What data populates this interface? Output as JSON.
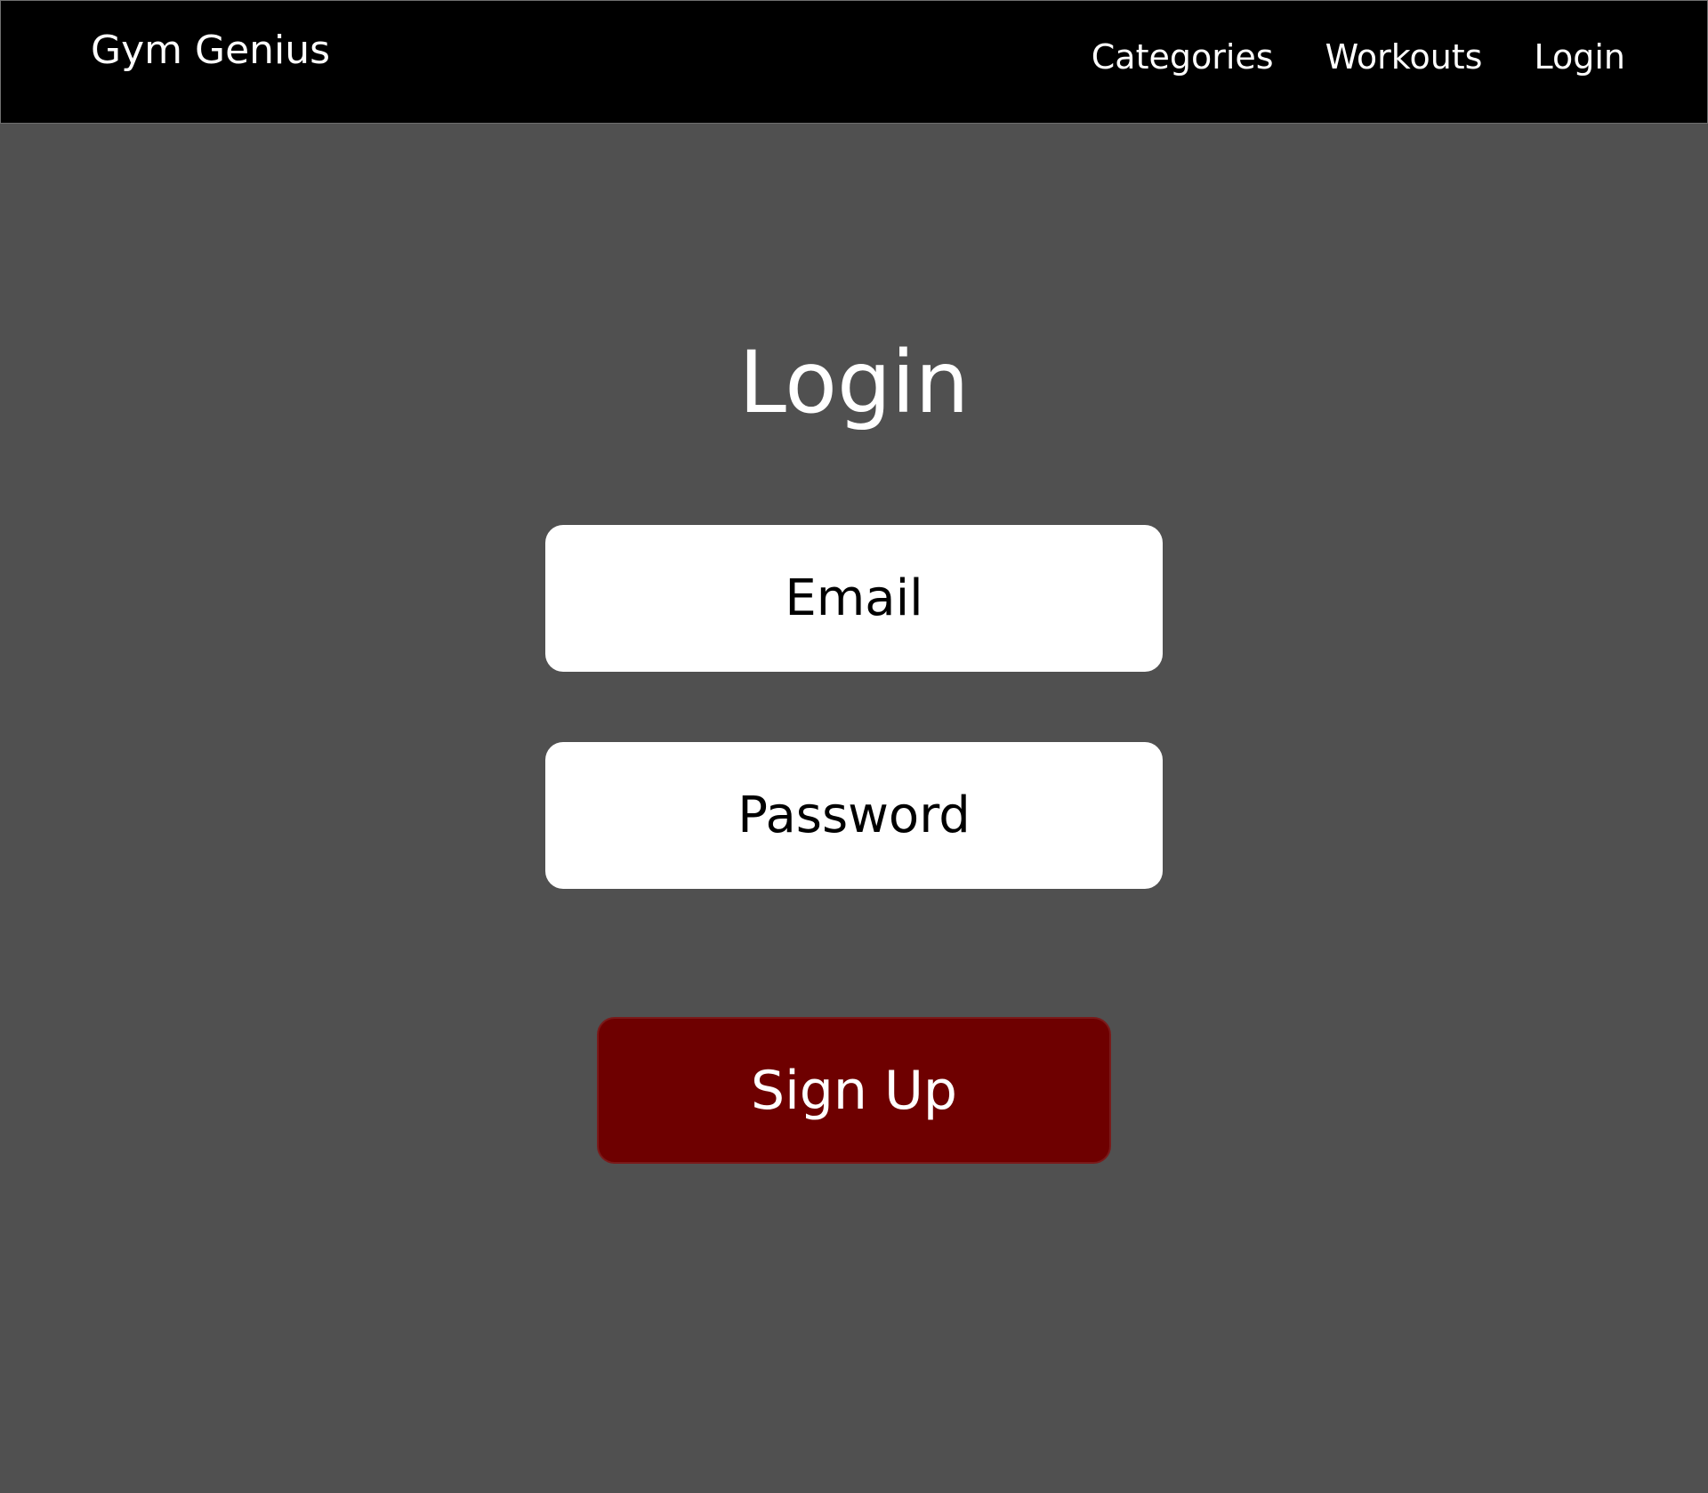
{
  "header": {
    "brand": "Gym Genius",
    "nav": [
      {
        "label": "Categories"
      },
      {
        "label": "Workouts"
      },
      {
        "label": "Login"
      }
    ]
  },
  "main": {
    "title": "Login",
    "email_field": {
      "placeholder": "Email"
    },
    "password_field": {
      "placeholder": "Password"
    },
    "signup_button": {
      "label": "Sign Up"
    }
  },
  "colors": {
    "page_background": "#505050",
    "navbar_background": "#000000",
    "button_background": "#6e0000",
    "text_light": "#ffffff",
    "text_dark": "#000000"
  }
}
